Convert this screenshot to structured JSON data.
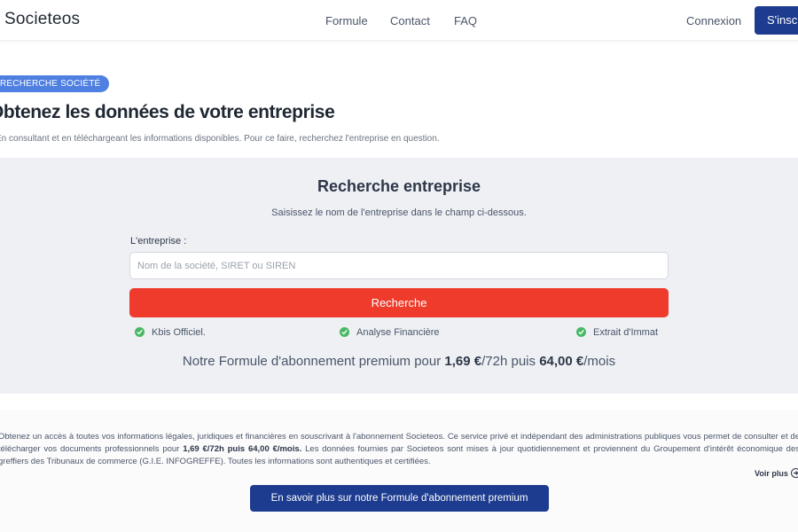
{
  "header": {
    "logo": "Societeos",
    "nav": [
      "Formule",
      "Contact",
      "FAQ"
    ],
    "login": "Connexion",
    "signup": "S'inscrire"
  },
  "hero": {
    "badge": "RECHERCHE SOCIÉTÉ",
    "title": "Obtenez les données de votre entreprise",
    "subtitle": "En consultant et en téléchargeant les informations disponibles. Pour ce faire, recherchez l'entreprise en question."
  },
  "search": {
    "title": "Recherche entreprise",
    "subtitle": "Saisissez le nom de l'entreprise dans le champ ci-dessous.",
    "label": "L'entreprise :",
    "placeholder": "Nom de la société, SIRET ou SIREN",
    "value": "",
    "button": "Recherche"
  },
  "features": [
    "Kbis Officiel.",
    "Analyse Financière",
    "Extrait d'Immat"
  ],
  "pricing": {
    "prefix": "Notre Formule d'abonnement premium pour ",
    "price1": "1,69 €",
    "mid": "/72h puis ",
    "price2": "64,00 €",
    "suffix": "/mois"
  },
  "info": {
    "part1": "Obtenez un accès à toutes vos informations légales, juridiques et financières en souscrivant à l'abonnement Societeos. Ce service privé et indépendant des administrations publiques vous permet de consulter et de télécharger vos documents professionnels pour ",
    "bold": "1,69 €/72h puis 64,00 €/mois.",
    "part2": " Les données fournies par Societeos sont mises à jour quotidiennement et proviennent du Groupement d'intérêt économique des greffiers des Tribunaux de commerce (G.I.E. INFOGREFFE). Toutes les informations sont authentiques et certifiées.",
    "voir_plus": "Voir plus",
    "cta": "En savoir plus sur notre Formule d'abonnement premium"
  },
  "colors": {
    "primary": "#1d3c8f",
    "accent": "#ee3b2b",
    "badge": "#4f7fe0",
    "check": "#48b865"
  },
  "icons": {
    "feature": "check-circle-icon",
    "voir_plus": "arrow-right-circle-icon"
  }
}
